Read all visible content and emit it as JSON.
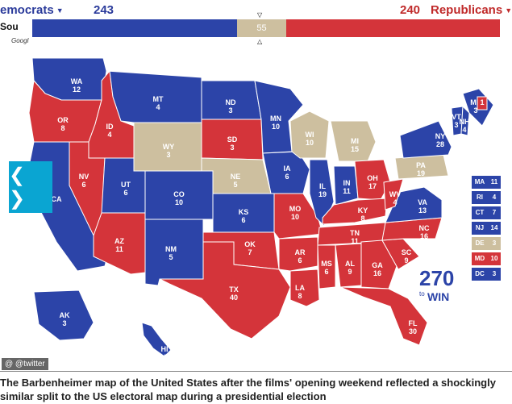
{
  "header": {
    "dem_label": "emocrats",
    "dem_count": "243",
    "rep_count": "240",
    "rep_label": "Republicans",
    "side_source": "Sou",
    "side_google": "Googl",
    "tie_value": "55",
    "caret_glyph": "▼"
  },
  "colors": {
    "dem": "#2c44a8",
    "rep": "#d4343a",
    "toss": "#cdbf9f"
  },
  "nav": {
    "label": "❮ ❯"
  },
  "states": [
    {
      "abbr": "WA",
      "ev": "12",
      "party": "dem"
    },
    {
      "abbr": "OR",
      "ev": "8",
      "party": "rep"
    },
    {
      "abbr": "CA",
      "ev": "",
      "party": "dem"
    },
    {
      "abbr": "ID",
      "ev": "4",
      "party": "rep"
    },
    {
      "abbr": "NV",
      "ev": "6",
      "party": "rep"
    },
    {
      "abbr": "MT",
      "ev": "4",
      "party": "dem"
    },
    {
      "abbr": "WY",
      "ev": "3",
      "party": "toss"
    },
    {
      "abbr": "UT",
      "ev": "6",
      "party": "dem"
    },
    {
      "abbr": "AZ",
      "ev": "11",
      "party": "rep"
    },
    {
      "abbr": "CO",
      "ev": "10",
      "party": "dem"
    },
    {
      "abbr": "NM",
      "ev": "5",
      "party": "dem"
    },
    {
      "abbr": "ND",
      "ev": "3",
      "party": "dem"
    },
    {
      "abbr": "SD",
      "ev": "3",
      "party": "rep"
    },
    {
      "abbr": "NE",
      "ev": "5",
      "party": "toss"
    },
    {
      "abbr": "KS",
      "ev": "6",
      "party": "dem"
    },
    {
      "abbr": "OK",
      "ev": "7",
      "party": "rep"
    },
    {
      "abbr": "TX",
      "ev": "40",
      "party": "rep"
    },
    {
      "abbr": "MN",
      "ev": "10",
      "party": "dem"
    },
    {
      "abbr": "IA",
      "ev": "6",
      "party": "dem"
    },
    {
      "abbr": "MO",
      "ev": "10",
      "party": "rep"
    },
    {
      "abbr": "AR",
      "ev": "6",
      "party": "rep"
    },
    {
      "abbr": "LA",
      "ev": "8",
      "party": "rep"
    },
    {
      "abbr": "WI",
      "ev": "10",
      "party": "toss"
    },
    {
      "abbr": "IL",
      "ev": "19",
      "party": "dem"
    },
    {
      "abbr": "MI",
      "ev": "15",
      "party": "toss"
    },
    {
      "abbr": "IN",
      "ev": "11",
      "party": "dem"
    },
    {
      "abbr": "OH",
      "ev": "17",
      "party": "rep"
    },
    {
      "abbr": "KY",
      "ev": "8",
      "party": "rep"
    },
    {
      "abbr": "TN",
      "ev": "11",
      "party": "rep"
    },
    {
      "abbr": "MS",
      "ev": "6",
      "party": "rep"
    },
    {
      "abbr": "AL",
      "ev": "9",
      "party": "rep"
    },
    {
      "abbr": "GA",
      "ev": "16",
      "party": "rep"
    },
    {
      "abbr": "FL",
      "ev": "30",
      "party": "rep"
    },
    {
      "abbr": "SC",
      "ev": "9",
      "party": "rep"
    },
    {
      "abbr": "NC",
      "ev": "16",
      "party": "rep"
    },
    {
      "abbr": "VA",
      "ev": "13",
      "party": "dem"
    },
    {
      "abbr": "WV",
      "ev": "4",
      "party": "rep"
    },
    {
      "abbr": "PA",
      "ev": "19",
      "party": "toss"
    },
    {
      "abbr": "NY",
      "ev": "28",
      "party": "dem"
    },
    {
      "abbr": "VT",
      "ev": "3",
      "party": "dem"
    },
    {
      "abbr": "NH",
      "ev": "4",
      "party": "dem"
    },
    {
      "abbr": "ME",
      "ev": "3",
      "party": "dem"
    },
    {
      "abbr": "ME-2",
      "ev": "1",
      "party": "rep"
    },
    {
      "abbr": "AK",
      "ev": "3",
      "party": "dem"
    },
    {
      "abbr": "HI",
      "ev": "4",
      "party": "dem"
    }
  ],
  "legend": [
    {
      "abbr": "MA",
      "ev": "11",
      "party": "dem"
    },
    {
      "abbr": "RI",
      "ev": "4",
      "party": "dem"
    },
    {
      "abbr": "CT",
      "ev": "7",
      "party": "dem"
    },
    {
      "abbr": "NJ",
      "ev": "14",
      "party": "dem"
    },
    {
      "abbr": "DE",
      "ev": "3",
      "party": "toss"
    },
    {
      "abbr": "MD",
      "ev": "10",
      "party": "rep"
    },
    {
      "abbr": "DC",
      "ev": "3",
      "party": "dem"
    }
  ],
  "logo": {
    "number": "270",
    "to": "to",
    "win": "WIN"
  },
  "watermark": "@ @twitter",
  "caption": "The Barbenheimer map of the United States after the films' opening weekend reflected a shockingly similar split to the US electoral map during a presidential election"
}
